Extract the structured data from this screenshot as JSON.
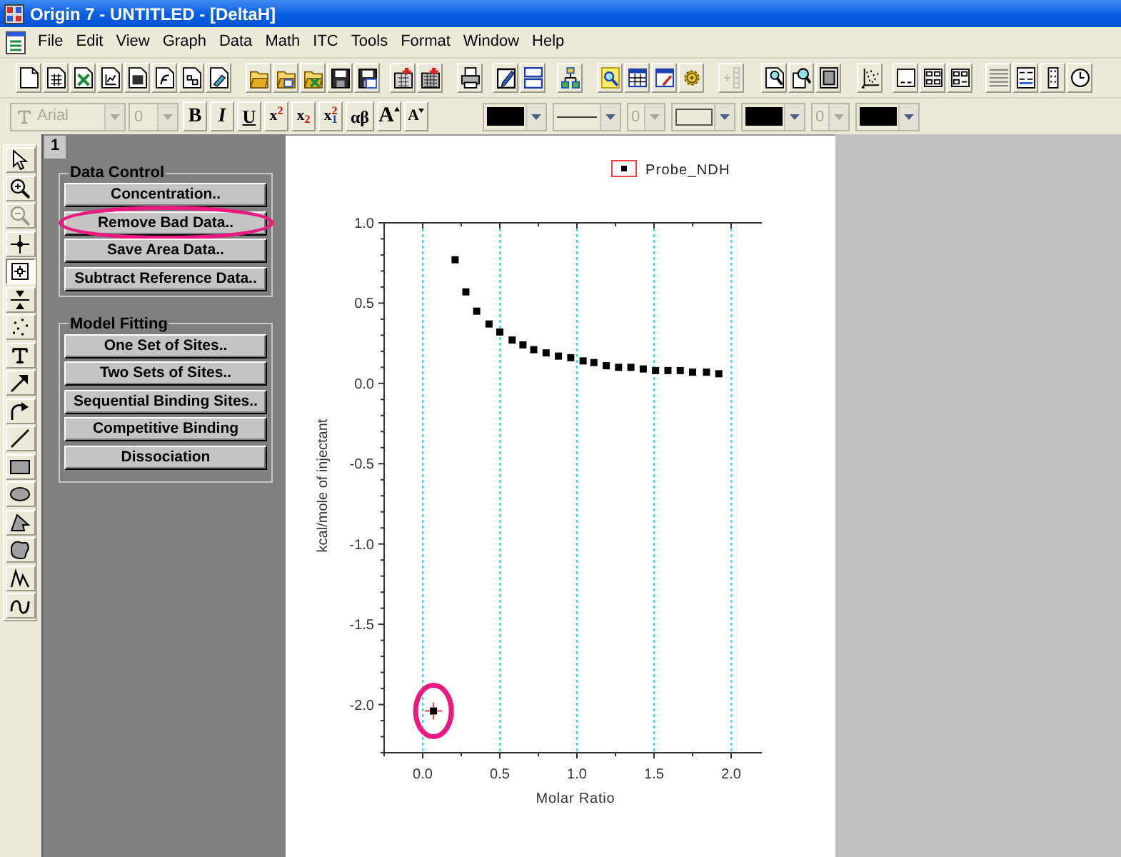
{
  "window": {
    "title": "Origin 7 - UNTITLED - [DeltaH]"
  },
  "menu": [
    "File",
    "Edit",
    "View",
    "Graph",
    "Data",
    "Math",
    "ITC",
    "Tools",
    "Format",
    "Window",
    "Help"
  ],
  "standard_toolbar": [
    {
      "disabled": false
    },
    {
      "disabled": false
    },
    {
      "disabled": false
    },
    {
      "disabled": false
    },
    {
      "disabled": false
    },
    {
      "disabled": false
    },
    {
      "disabled": false
    },
    {
      "disabled": false
    },
    {
      "disabled": false
    },
    {
      "disabled": false
    },
    {
      "disabled": false
    },
    {
      "disabled": false
    },
    {
      "disabled": false
    },
    {
      "disabled": false
    },
    {
      "disabled": false
    },
    {
      "disabled": false
    },
    {
      "disabled": false
    },
    {
      "disabled": false
    },
    {
      "disabled": false
    },
    {
      "disabled": false
    },
    {
      "disabled": false
    },
    {
      "disabled": false
    },
    {
      "disabled": false
    },
    {
      "disabled": true
    },
    {
      "disabled": false
    },
    {
      "disabled": false
    },
    {
      "disabled": false
    },
    {
      "disabled": false
    },
    {
      "disabled": false
    },
    {
      "disabled": false
    },
    {
      "disabled": false
    },
    {
      "disabled": false
    },
    {
      "disabled": false
    },
    {
      "disabled": false
    },
    {
      "disabled": false
    }
  ],
  "format_toolbar": {
    "font": {
      "value": "Arial",
      "disabled": true
    },
    "font_size": {
      "value": "0",
      "disabled": true
    },
    "buttons": [
      {
        "kind": "bold",
        "label": "B"
      },
      {
        "kind": "italic",
        "label": "I"
      },
      {
        "kind": "underline",
        "label": "U"
      },
      {
        "kind": "superscript",
        "label": "x$^{2}$"
      },
      {
        "kind": "subscript",
        "label": "x$_{2}$"
      },
      {
        "kind": "supsub",
        "label": "x$^{2}$$_{1}$"
      },
      {
        "kind": "greek",
        "label": "αβ"
      },
      {
        "kind": "grow",
        "label": "A"
      },
      {
        "kind": "shrink",
        "label": "A"
      }
    ]
  },
  "style_toolbar": [
    {
      "kind": "color",
      "color": "#000000"
    },
    {
      "kind": "line"
    },
    {
      "kind": "number",
      "value": "0",
      "disabled": true
    },
    {
      "kind": "box"
    },
    {
      "kind": "color",
      "color": "#000000"
    },
    {
      "kind": "number",
      "value": "0",
      "disabled": true
    },
    {
      "kind": "color",
      "color": "#000000"
    }
  ],
  "tools": [
    {
      "selected": false,
      "disabled": false
    },
    {
      "selected": false,
      "disabled": false
    },
    {
      "selected": false,
      "disabled": true
    },
    {
      "selected": false,
      "disabled": false
    },
    {
      "selected": true,
      "disabled": false
    },
    {
      "selected": false,
      "disabled": false
    },
    {
      "selected": false,
      "disabled": false
    },
    {
      "selected": false,
      "disabled": false
    },
    {
      "selected": false,
      "disabled": false
    },
    {
      "selected": false,
      "disabled": false
    },
    {
      "selected": false,
      "disabled": false
    },
    {
      "selected": false,
      "disabled": false
    },
    {
      "selected": false,
      "disabled": false
    },
    {
      "selected": false,
      "disabled": false
    },
    {
      "selected": false,
      "disabled": false
    },
    {
      "selected": false,
      "disabled": false
    },
    {
      "selected": false,
      "disabled": false
    }
  ],
  "layer_tab": "1",
  "data_control": {
    "title": "Data Control",
    "buttons": [
      {
        "label": "Concentration..",
        "highlighted": false
      },
      {
        "label": "Remove Bad Data..",
        "highlighted": true
      },
      {
        "label": "Save Area Data..",
        "highlighted": false
      },
      {
        "label": "Subtract Reference Data..",
        "highlighted": false
      }
    ]
  },
  "model_fitting": {
    "title": "Model Fitting",
    "buttons": [
      {
        "label": "One Set of Sites..",
        "highlighted": false
      },
      {
        "label": "Two Sets of Sites..",
        "highlighted": false
      },
      {
        "label": "Sequential Binding Sites..",
        "highlighted": false
      },
      {
        "label": "Competitive Binding",
        "highlighted": false
      },
      {
        "label": "Dissociation",
        "highlighted": false
      }
    ]
  },
  "graph": {
    "chart_data": {
      "type": "scatter",
      "xlabel": "Molar Ratio",
      "ylabel": "kcal/mole of injectant",
      "grid": "x",
      "xlim": [
        -0.25,
        2.2
      ],
      "ylim": [
        -2.3,
        1.0
      ],
      "xticks": [
        {
          "value": 0,
          "label": "0.0"
        },
        {
          "value": 0.5,
          "label": "0.5"
        },
        {
          "value": 1,
          "label": "1.0"
        },
        {
          "value": 1.5,
          "label": "1.5"
        },
        {
          "value": 2,
          "label": "2.0"
        }
      ],
      "yticks": [
        {
          "value": -2,
          "label": "-2.0"
        },
        {
          "value": -1.5,
          "label": "-1.5"
        },
        {
          "value": -1,
          "label": "-1.0"
        },
        {
          "value": -0.5,
          "label": "-0.5"
        },
        {
          "value": 0,
          "label": "0.0"
        },
        {
          "value": 0.5,
          "label": "0.5"
        },
        {
          "value": 1,
          "label": "1.0"
        }
      ],
      "x": [
        0.07,
        0.21,
        0.28,
        0.35,
        0.43,
        0.5,
        0.58,
        0.65,
        0.72,
        0.8,
        0.88,
        0.96,
        1.04,
        1.11,
        1.19,
        1.27,
        1.35,
        1.43,
        1.51,
        1.59,
        1.67,
        1.75,
        1.84,
        1.92
      ],
      "series": [
        {
          "name": "Probe_NDH",
          "color": "#000000",
          "values": [
            -2.04,
            0.77,
            0.57,
            0.45,
            0.37,
            0.32,
            0.27,
            0.24,
            0.21,
            0.19,
            0.17,
            0.16,
            0.14,
            0.13,
            0.11,
            0.1,
            0.1,
            0.09,
            0.08,
            0.08,
            0.08,
            0.07,
            0.07,
            0.06
          ]
        }
      ]
    },
    "first_point": {
      "selected": true,
      "circled": true
    }
  }
}
